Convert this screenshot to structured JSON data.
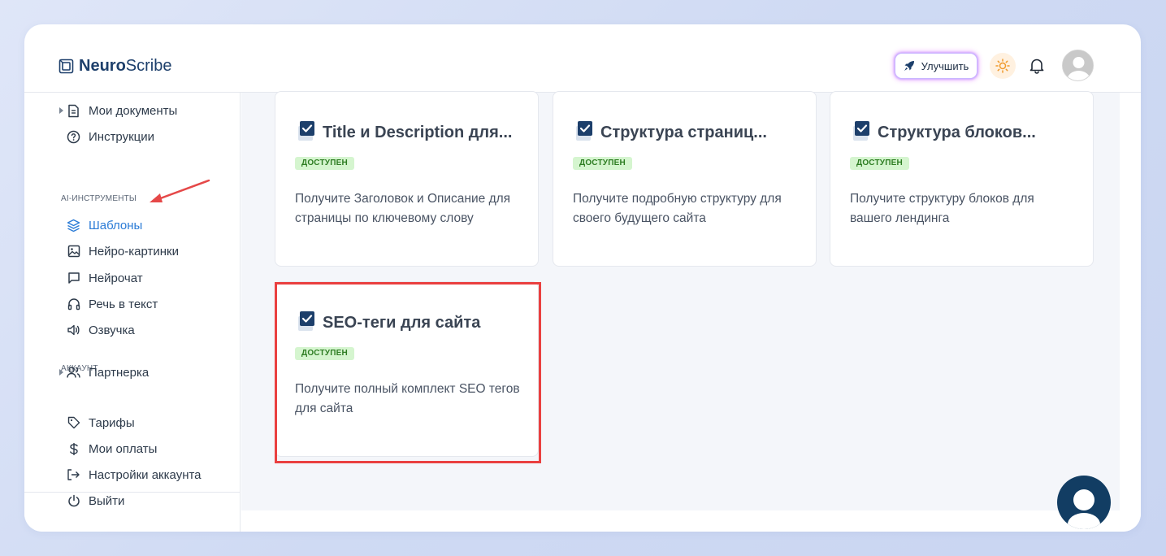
{
  "brand": {
    "name_bold": "Neuro",
    "name_regular": "Scribe",
    "color": "#1d3f6b"
  },
  "header": {
    "upgrade_label": "Улучшить",
    "icons": [
      "rocket-icon",
      "sun-icon",
      "bell-icon",
      "avatar"
    ]
  },
  "sidebar": {
    "items_top": [
      {
        "label": "Мои документы",
        "icon": "document-icon",
        "expandable": true
      },
      {
        "label": "Инструкции",
        "icon": "help-circle-icon",
        "expandable": false
      }
    ],
    "section_ai": "AI-ИНСТРУМЕНТЫ",
    "items_ai": [
      {
        "label": "Шаблоны",
        "icon": "layers-icon",
        "active": true
      },
      {
        "label": "Нейро-картинки",
        "icon": "image-icon"
      },
      {
        "label": "Нейрочат",
        "icon": "chat-icon"
      },
      {
        "label": "Речь в текст",
        "icon": "headphones-icon"
      },
      {
        "label": "Озвучка",
        "icon": "speaker-icon"
      }
    ],
    "section_account": "АККАУНТ",
    "items_account": [
      {
        "label": "Партнерка",
        "icon": "users-icon",
        "expandable": true
      },
      {
        "label": "Тарифы",
        "icon": "tag-icon"
      },
      {
        "label": "Мои оплаты",
        "icon": "dollar-icon"
      },
      {
        "label": "Настройки аккаунта",
        "icon": "login-icon"
      },
      {
        "label": "Выйти",
        "icon": "power-icon"
      }
    ],
    "active_color": "#2b7bd6"
  },
  "templates": [
    {
      "title": "Title и Description для...",
      "badge": "ДОСТУПЕН",
      "description": "Получите Заголовок и Описание для страницы по ключевому слову"
    },
    {
      "title": "Структура страниц...",
      "badge": "ДОСТУПЕН",
      "description": "Получите подробную структуру для своего будущего сайта"
    },
    {
      "title": "Структура блоков...",
      "badge": "ДОСТУПЕН",
      "description": "Получите структуру блоков для вашего лендинга"
    },
    {
      "title": "SEO-теги для сайта",
      "badge": "ДОСТУПЕН",
      "description": "Получите полный комплект SEO тегов для сайта"
    }
  ],
  "colors": {
    "badge_bg": "#d5f5cf",
    "badge_text": "#2e7d23",
    "highlight": "#ea4040",
    "annotation_arrow": "#e54848",
    "chat_fab": "#123d63"
  }
}
